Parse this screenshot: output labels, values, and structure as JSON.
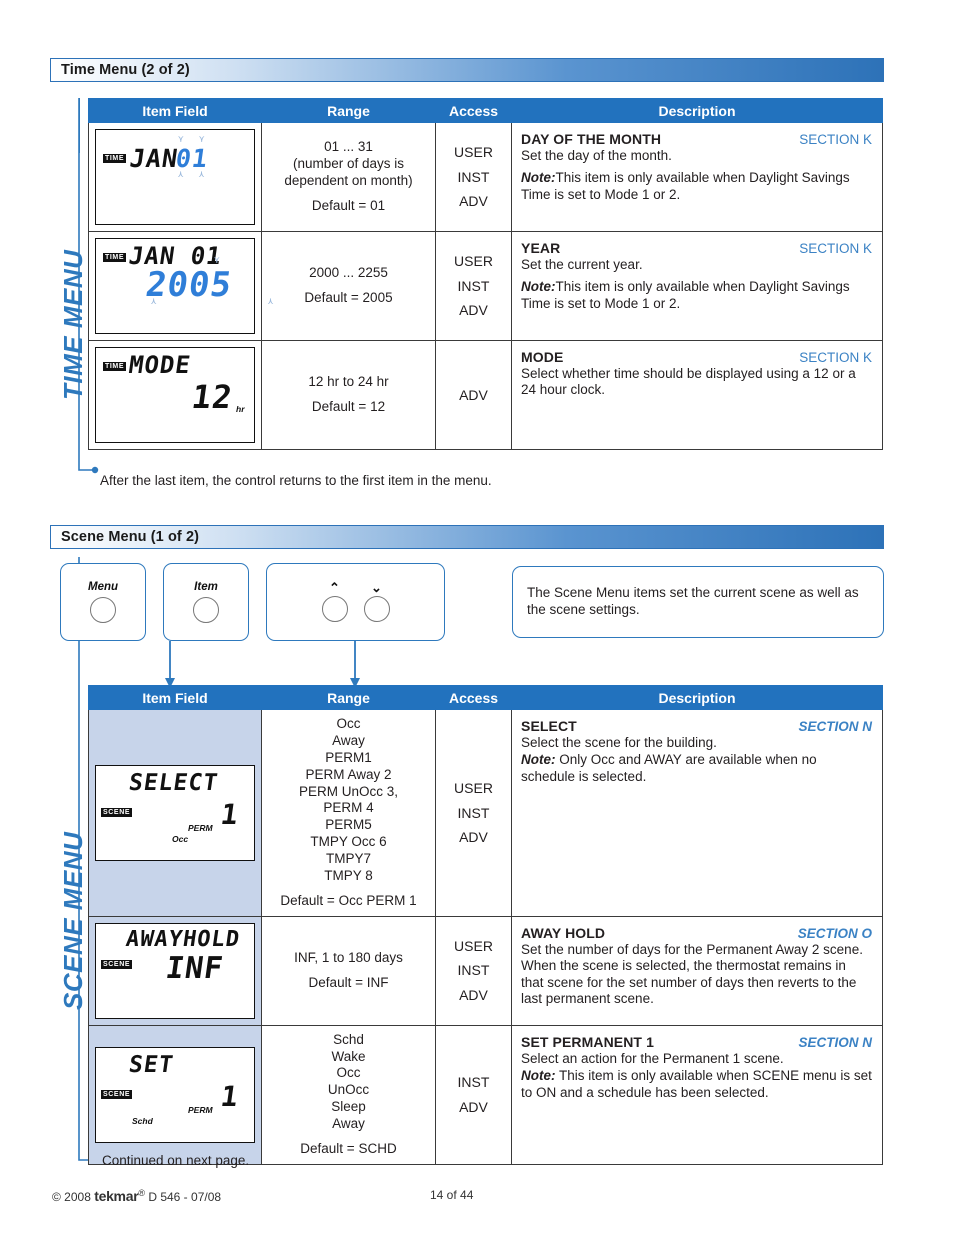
{
  "sections": [
    {
      "bar_title": "Time Menu (2 of 2)",
      "side_label": "TIME MENU",
      "columns": [
        "Item Field",
        "Range",
        "Access",
        "Description"
      ],
      "rows": [
        {
          "lcd": {
            "badge": "TIME",
            "line1": "JAN",
            "value": "01",
            "value_color": "#2f7ed8"
          },
          "range": [
            "01 ... 31",
            "(number of days is",
            "dependent on month)"
          ],
          "range_default": "Default = 01",
          "access": [
            "USER",
            "INST",
            "ADV"
          ],
          "desc_title": "DAY OF THE MONTH",
          "desc_section": "SECTION K",
          "desc_body": "Set the day of the month.",
          "note_label": "Note:",
          "note_body": "This item is only available when Daylight Savings Time is set to Mode 1 or 2."
        },
        {
          "lcd": {
            "badge": "TIME",
            "line1": "JAN 01",
            "value": "2005",
            "value_color": "#2f7ed8"
          },
          "range": [
            "2000 ... 2255"
          ],
          "range_default": "Default = 2005",
          "access": [
            "USER",
            "INST",
            "ADV"
          ],
          "desc_title": "YEAR",
          "desc_section": "SECTION K",
          "desc_body": "Set the current year.",
          "note_label": "Note:",
          "note_body": "This item is only available when Daylight Savings Time is set to Mode 1 or 2."
        },
        {
          "lcd": {
            "badge": "TIME",
            "line1": "MODE",
            "value": "12",
            "unit": "hr",
            "value_color": "#111111"
          },
          "range": [
            "12 hr to 24 hr"
          ],
          "range_default": "Default = 12",
          "access": [
            "ADV"
          ],
          "desc_title": "MODE",
          "desc_section": "SECTION K",
          "desc_body": "Select whether time should be displayed using a 12 or a 24 hour clock.",
          "note_label": "",
          "note_body": ""
        }
      ],
      "tail_note": "After the last item, the control returns to the first item in the menu."
    },
    {
      "bar_title": "Scene Menu (1 of 2)",
      "side_label": "SCENE MENU",
      "columns": [
        "Item Field",
        "Range",
        "Access",
        "Description"
      ],
      "keys": [
        {
          "label": "Menu",
          "type": "single"
        },
        {
          "label": "Item",
          "type": "single"
        },
        {
          "label": "",
          "type": "updown",
          "up": "⌃",
          "down": "⌄"
        }
      ],
      "info": "The Scene Menu items set the current scene as well as the scene settings.",
      "rows": [
        {
          "lcd": {
            "badge": "SCENE",
            "line1": "SELECT",
            "value": "1",
            "value_color": "#111111",
            "tag_perm": "PERM",
            "tag_occ": "Occ",
            "shaded": true
          },
          "range": [
            "Occ",
            "Away",
            "PERM1",
            "PERM Away 2",
            "PERM UnOcc 3,",
            "PERM 4",
            "PERM5",
            "TMPY Occ 6",
            "TMPY7",
            "TMPY 8"
          ],
          "range_default": "Default = Occ PERM 1",
          "access": [
            "USER",
            "INST",
            "ADV"
          ],
          "desc_title": "SELECT",
          "desc_section": "SECTION N",
          "desc_body": "Select the scene for the building.",
          "note_label": "Note:",
          "note_body": "Only Occ and AWAY are available when no schedule is selected."
        },
        {
          "lcd": {
            "badge": "SCENE",
            "line1": "AWAYHOLD",
            "value": "INF",
            "value_color": "#111111",
            "shaded": true
          },
          "range": [
            "INF, 1 to 180 days"
          ],
          "range_default": "Default = INF",
          "access": [
            "USER",
            "INST",
            "ADV"
          ],
          "desc_title": "AWAY HOLD",
          "desc_section": "SECTION O",
          "desc_body": "Set the number of days for the Permanent Away 2 scene. When the scene is selected, the thermostat remains in that scene for the set number of days then reverts to the last permanent scene.",
          "note_label": "",
          "note_body": ""
        },
        {
          "lcd": {
            "badge": "SCENE",
            "line1": "SET",
            "value": "1",
            "value_color": "#111111",
            "tag_perm": "PERM",
            "tag_occ": "Schd",
            "shaded": true
          },
          "range": [
            "Schd",
            "Wake",
            "Occ",
            "UnOcc",
            "Sleep",
            "Away"
          ],
          "range_default": "Default = SCHD",
          "access": [
            "INST",
            "ADV"
          ],
          "desc_title": "SET PERMANENT 1",
          "desc_section": "SECTION N",
          "desc_body": "Select an action for the Permanent 1 scene.",
          "note_label": "Note:",
          "note_body": "This item is only available when SCENE menu is set to ON and a schedule has been selected."
        }
      ],
      "tail_note": "Continued on next page."
    }
  ],
  "footer": {
    "copyright": "© 2008",
    "brand": "tekmar",
    "brand_mark": "®",
    "doc": "D 546 - 07/08",
    "page": "14 of 44"
  },
  "colors": {
    "header_blue": "#2272be",
    "accent_blue": "#2e79bd",
    "lcd_blue": "#2f7ed8",
    "shaded_cell": "#c7d4ea"
  }
}
